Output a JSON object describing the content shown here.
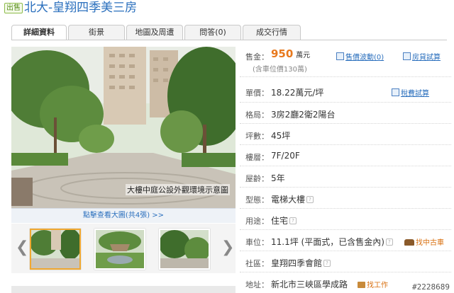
{
  "header": {
    "badge": "出售",
    "title": "北大-皇翔四季美三房"
  },
  "tabs": [
    {
      "label": "詳細資料",
      "active": true
    },
    {
      "label": "街景"
    },
    {
      "label": "地圖及周遭"
    },
    {
      "label": "問答(0)"
    },
    {
      "label": "成交行情"
    }
  ],
  "gallery": {
    "caption": "大樓中庭公設外觀環境示意圖",
    "more_link": "點擊查看大圖(共4張) >>",
    "prev": "❮",
    "next": "❯"
  },
  "details": {
    "price": {
      "label": "售金：",
      "value": "950",
      "unit": "萬元",
      "note": "(含車位價130萬)"
    },
    "price_tools": {
      "history": "售價波動(0)",
      "loan": "房貸試算"
    },
    "unit_price": {
      "label": "單價：",
      "value": "18.22萬元/坪",
      "tool": "稅費試算"
    },
    "layout": {
      "label": "格局：",
      "value": "3房2廳2衛2陽台"
    },
    "area": {
      "label": "坪數：",
      "value": "45坪"
    },
    "floor": {
      "label": "樓層：",
      "value": "7F/20F"
    },
    "age": {
      "label": "屋齡：",
      "value": "5年"
    },
    "type": {
      "label": "型態：",
      "value": "電梯大樓"
    },
    "usage": {
      "label": "用途：",
      "value": "住宅"
    },
    "parking": {
      "label": "車位：",
      "value": "11.1坪 (平面式，已含售金內)",
      "side": "找中古車"
    },
    "community": {
      "label": "社區：",
      "value": "皇翔四季會館"
    },
    "address": {
      "label": "地址：",
      "value": "新北市三峽區學成路",
      "side": "找工作"
    }
  },
  "watermark": "#2228689"
}
